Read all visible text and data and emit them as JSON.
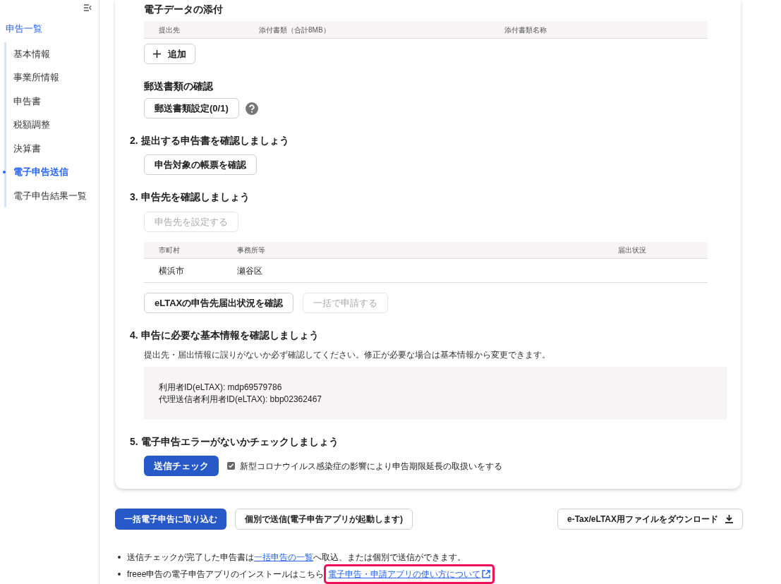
{
  "sidebar": {
    "title": "申告一覧",
    "items": [
      {
        "label": "基本情報",
        "selected": false
      },
      {
        "label": "事業所情報",
        "selected": false
      },
      {
        "label": "申告書",
        "selected": false
      },
      {
        "label": "税額調整",
        "selected": false
      },
      {
        "label": "決算書",
        "selected": false
      },
      {
        "label": "電子申告送信",
        "selected": true
      },
      {
        "label": "電子申告結果一覧",
        "selected": false
      }
    ]
  },
  "attachment": {
    "heading": "電子データの添付",
    "columns": [
      "提出先",
      "添付書類（合計8MB）",
      "添付書類名称"
    ],
    "add_button": "追加"
  },
  "mail_docs": {
    "heading": "郵送書類の確認",
    "button": "郵送書類設定(0/1)"
  },
  "step2": {
    "heading": "2. 提出する申告書を確認しましょう",
    "button": "申告対象の帳票を確認"
  },
  "step3": {
    "heading": "3. 申告先を確認しましょう",
    "set_button": {
      "label": "申告先を設定する",
      "disabled": true
    },
    "columns": [
      "市町村",
      "事務所等",
      "届出状況"
    ],
    "rows": [
      [
        "横浜市",
        "瀬谷区"
      ]
    ],
    "buttons": [
      {
        "label": "eLTAXの申告先届出状況を確認",
        "disabled": false
      },
      {
        "label": "一括で申請する",
        "disabled": true
      }
    ]
  },
  "step4": {
    "heading": "4. 申告に必要な基本情報を確認しましょう",
    "description": "提出先・届出情報に誤りがないか必ず確認してください。修正が必要な場合は基本情報から変更できます。",
    "info_lines": [
      "利用者ID(eLTAX): mdp69579786",
      "代理送信者利用者ID(eLTAX): bbp02362467"
    ]
  },
  "step5": {
    "heading": "5. 電子申告エラーがないかチェックしましょう",
    "button": "送信チェック",
    "checkbox": {
      "label": "新型コロナウイルス感染症の影響により申告期限延長の取扱いをする",
      "checked": true
    }
  },
  "actions": [
    {
      "label": "一括電子申告に取り込む",
      "kind": "primary"
    },
    {
      "label": "個別で送信(電子申告アプリが起動します)",
      "kind": "secondary"
    },
    {
      "label": "e-Tax/eLTAX用ファイルをダウンロード",
      "kind": "download"
    }
  ],
  "notes": [
    {
      "before": "送信チェックが完了した申告書は",
      "link": "一括申告の一覧",
      "after": "へ取込、または個別で送信ができます。",
      "external": false,
      "highlighted": false
    },
    {
      "before": "freee申告の電子申告アプリのインストールはこちら",
      "link": "電子申告・申請アプリの使い方について",
      "external": true,
      "highlighted": true
    }
  ]
}
